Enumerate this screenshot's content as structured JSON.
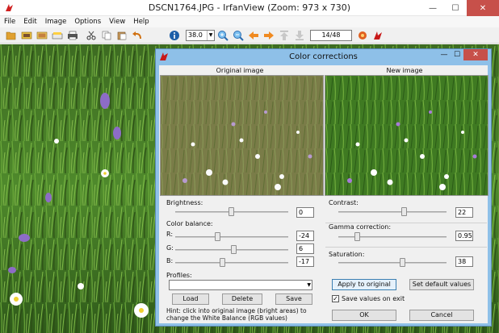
{
  "window": {
    "title": "DSCN1764.JPG - IrfanView (Zoom: 973 x 730)"
  },
  "menu": [
    "File",
    "Edit",
    "Image",
    "Options",
    "View",
    "Help"
  ],
  "toolbar": {
    "zoom_value": "38.0",
    "page_counter": "14/48"
  },
  "dialog": {
    "title": "Color corrections",
    "original_label": "Original image",
    "new_label": "New image",
    "brightness": {
      "label": "Brightness:",
      "value": "0",
      "level": 0.5
    },
    "color_balance": {
      "label": "Color balance:",
      "r": {
        "label": "R:",
        "value": "-24",
        "level": 0.38
      },
      "g": {
        "label": "G:",
        "value": "6",
        "level": 0.52
      },
      "b": {
        "label": "B:",
        "value": "-17",
        "level": 0.42
      }
    },
    "profiles": {
      "label": "Profiles:",
      "value": ""
    },
    "buttons": {
      "load": "Load",
      "delete": "Delete",
      "save": "Save"
    },
    "hint": "Hint: click into original image (bright areas) to change the White Balance (RGB values)",
    "contrast": {
      "label": "Contrast:",
      "value": "22",
      "level": 0.61
    },
    "gamma": {
      "label": "Gamma correction:",
      "value": "0.95",
      "level": 0.18
    },
    "saturation": {
      "label": "Saturation:",
      "value": "38",
      "level": 0.6
    },
    "apply_button": "Apply to original",
    "default_button": "Set default values",
    "save_on_exit": {
      "label": "Save values on exit",
      "checked": true
    },
    "ok": "OK",
    "cancel": "Cancel"
  },
  "colors": {
    "dialog_frame": "#8ec0e8",
    "close_button": "#c7504a",
    "grass_dark": "#2f5a1a",
    "grass_light": "#6fae3c"
  },
  "icons": [
    "open-folder-icon",
    "slideshow-icon",
    "thumbnails-icon",
    "save-icon",
    "print-icon",
    "cut-icon",
    "copy-icon",
    "paste-icon",
    "undo-icon",
    "info-icon",
    "zoom-in-icon",
    "zoom-out-icon",
    "prev-icon",
    "next-icon",
    "first-icon",
    "last-icon",
    "settings-icon",
    "irfanview-logo-icon"
  ]
}
